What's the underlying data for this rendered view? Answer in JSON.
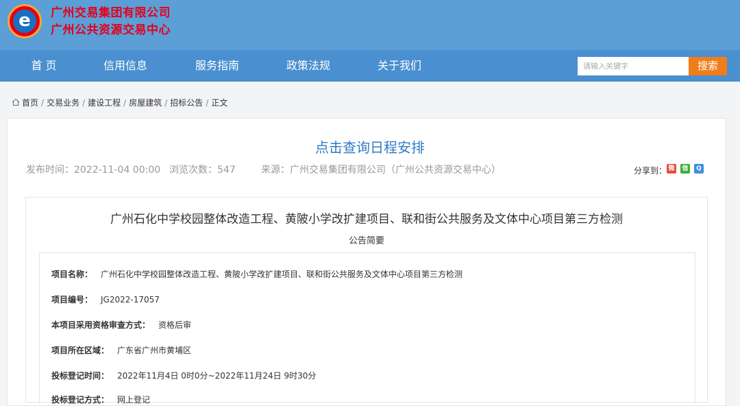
{
  "header": {
    "org_line1": "广州交易集团有限公司",
    "org_line2": "广州公共资源交易中心",
    "logo_letter": "e"
  },
  "nav": {
    "items": [
      "首 页",
      "信用信息",
      "服务指南",
      "政策法规",
      "关于我们"
    ],
    "search_placeholder": "请输入关键字",
    "search_button": "搜索"
  },
  "breadcrumb": [
    "首页",
    "交易业务",
    "建设工程",
    "房屋建筑",
    "招标公告",
    "正文"
  ],
  "article": {
    "title": "点击查询日程安排",
    "publish_time": "发布时间：2022-11-04 00:00",
    "views": "浏览次数：547",
    "source": "来源：广州交易集团有限公司（广州公共资源交易中心）",
    "share_label": "分享到：",
    "share_icons": [
      "weibo-icon",
      "wechat-icon",
      "qq-icon"
    ]
  },
  "announcement": {
    "title": "广州石化中学校园整体改造工程、黄陂小学改扩建项目、联和街公共服务及文体中心项目第三方检测",
    "subtitle": "公告简要",
    "fields": [
      {
        "key": "项目名称：",
        "value": "广州石化中学校园整体改造工程、黄陂小学改扩建项目、联和街公共服务及文体中心项目第三方检测"
      },
      {
        "key": "项目编号：",
        "value": "JG2022-17057"
      },
      {
        "key": "本项目采用资格审查方式：",
        "value": "资格后审"
      },
      {
        "key": "项目所在区域：",
        "value": "广东省广州市黄埔区"
      },
      {
        "key": "投标登记时间：",
        "value": "2022年11月4日 0时0分~2022年11月24日 9时30分"
      },
      {
        "key": "投标登记方式：",
        "value": "网上登记"
      }
    ]
  },
  "colors": {
    "header_bg": "#5b9fd6",
    "nav_bg": "#4a8fcf",
    "org_text": "#e4001b",
    "title_text": "#2d7bc6",
    "search_button": "#ef7d1a"
  }
}
